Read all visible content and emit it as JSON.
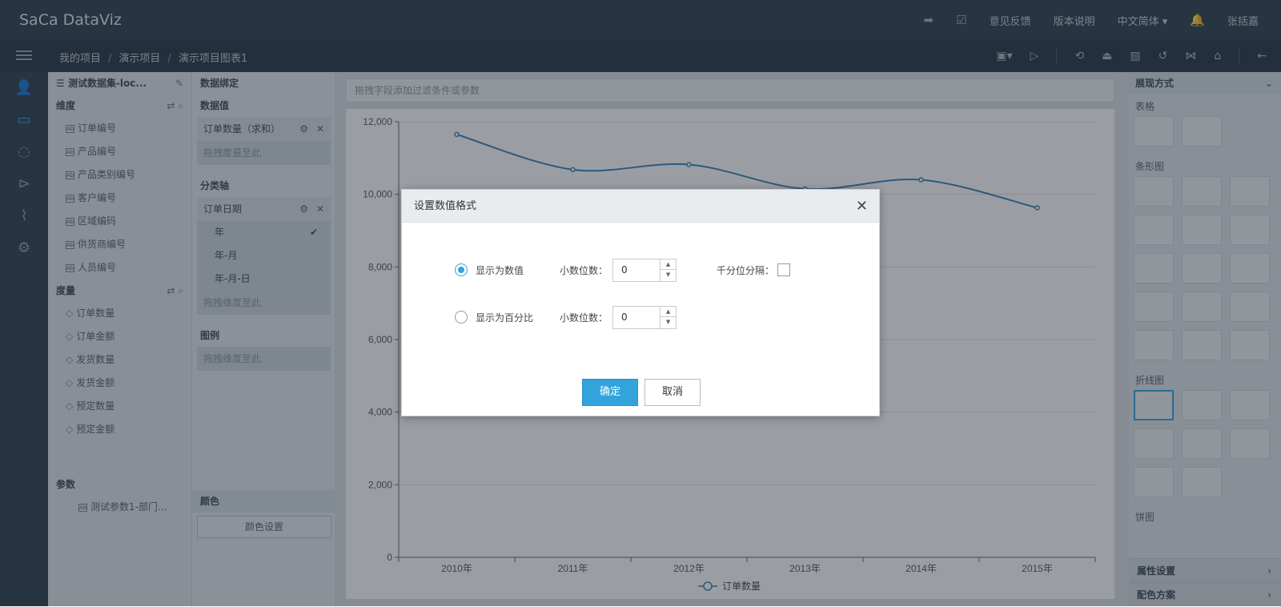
{
  "app": {
    "logo": "SaCa DataViz"
  },
  "topbar": {
    "feedback": "意见反馈",
    "release_notes": "版本说明",
    "language": "中文简体 ▾",
    "user": "张括嘉",
    "share_icon": "share-icon",
    "edit_icon": "edit-icon",
    "bell_icon": "bell-icon"
  },
  "breadcrumb": {
    "items": [
      "我的项目",
      "演示项目",
      "演示项目图表1"
    ],
    "sep": "/"
  },
  "toolbar": {
    "icons": [
      "save-icon",
      "play-icon",
      "history-icon",
      "publish-icon",
      "image-icon",
      "undo-icon",
      "share-icon",
      "tag-icon",
      "back-icon"
    ]
  },
  "leftnav": {
    "icons": [
      "user-icon",
      "screen-icon",
      "cycle-icon",
      "play-circle-icon",
      "chart-icon",
      "settings-icon"
    ]
  },
  "dataset": {
    "title": "测试数据集-loc...",
    "dim_label": "维度",
    "dimensions": [
      "订单编号",
      "产品编号",
      "产品类别编号",
      "客户编号",
      "区域编码",
      "供货商编号",
      "人员编号"
    ],
    "measure_label": "度量",
    "measures": [
      "订单数量",
      "订单金额",
      "发货数量",
      "发货金额",
      "预定数量",
      "预定金额"
    ],
    "params_label": "参数",
    "params": [
      "测试参数1-部门..."
    ]
  },
  "binding": {
    "title": "数据绑定",
    "values_label": "数据值",
    "value_chip": "订单数量（求和）",
    "value_drop": "拖拽度量至此",
    "axis_label": "分类轴",
    "axis_chip": "订单日期",
    "axis_options": [
      "年",
      "年-月",
      "年-月-日"
    ],
    "axis_drop": "拖拽维度至此",
    "legend_label": "图例",
    "legend_drop": "拖拽维度至此",
    "color_label": "颜色",
    "color_button": "颜色设置"
  },
  "filterbar": {
    "placeholder": "拖拽字段添加过滤条件或参数"
  },
  "chart_data": {
    "type": "line",
    "categories": [
      "2010年",
      "2011年",
      "2012年",
      "2013年",
      "2014年",
      "2015年"
    ],
    "series": [
      {
        "name": "订单数量",
        "values": [
          11650,
          10680,
          10820,
          10150,
          10400,
          9630
        ]
      }
    ],
    "ylim": [
      0,
      12000
    ],
    "yticks": [
      "0",
      "2,000",
      "4,000",
      "6,000",
      "8,000",
      "10,000",
      "12,000"
    ],
    "grid": true,
    "legend": "bottom",
    "color": "#3a82b5"
  },
  "right_panel": {
    "title": "展现方式",
    "sections": [
      "表格",
      "条形图",
      "折线图",
      "饼图"
    ],
    "attr_settings": "属性设置",
    "color_scheme": "配色方案"
  },
  "dialog": {
    "title": "设置数值格式",
    "option_number": "显示为数值",
    "option_percent": "显示为百分比",
    "decimals_label": "小数位数：",
    "decimals_number": "0",
    "decimals_percent": "0",
    "thousands_label": "千分位分隔：",
    "ok": "确定",
    "cancel": "取消",
    "accent": "#33a3dc"
  }
}
